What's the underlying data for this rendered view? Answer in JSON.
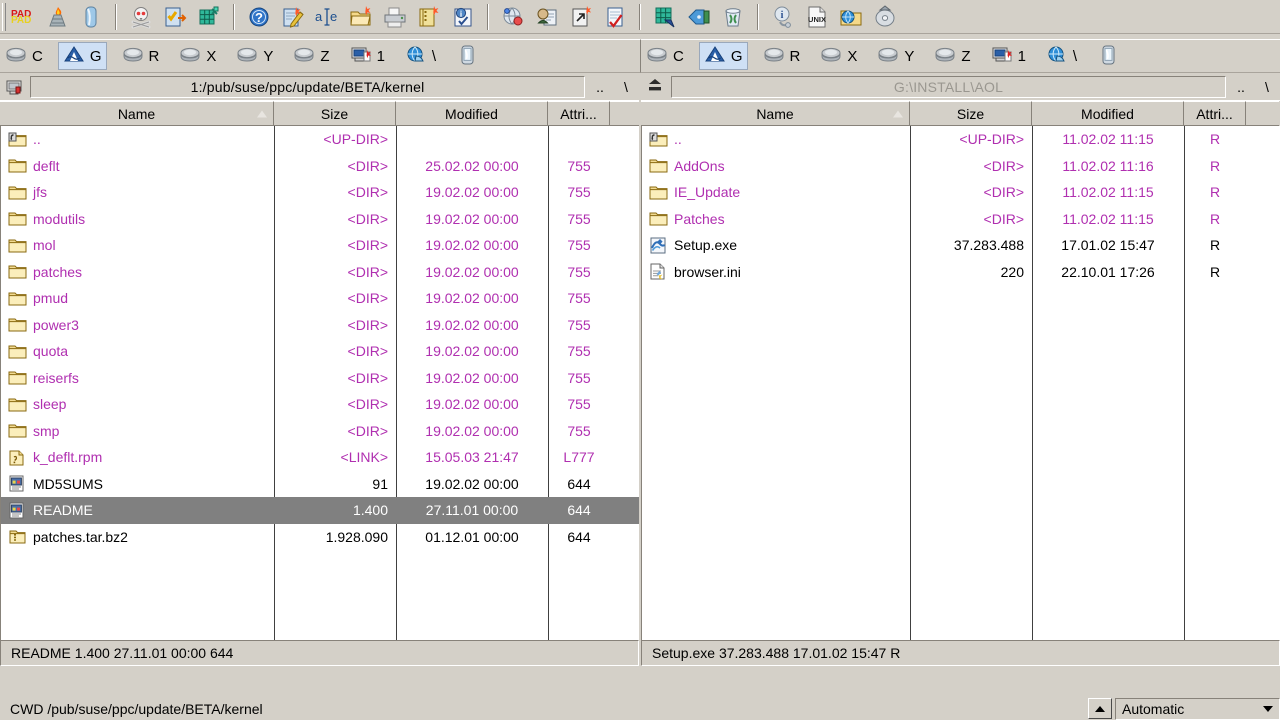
{
  "toolbar": {
    "groups": [
      {
        "buttons": [
          {
            "name": "pad-logo-icon",
            "label": "PAD"
          },
          {
            "name": "torch-icon",
            "label": "Torch"
          },
          {
            "name": "blue-column-icon",
            "label": "Column"
          }
        ]
      },
      {
        "buttons": [
          {
            "name": "skull-icon",
            "label": "Kill Process"
          },
          {
            "name": "checklist-page-icon",
            "label": "Select"
          },
          {
            "name": "green-grid-icon",
            "label": "Network Grid"
          }
        ]
      },
      {
        "buttons": [
          {
            "name": "help-icon",
            "label": "Help"
          },
          {
            "name": "edit-note-icon",
            "label": "Edit"
          },
          {
            "name": "rename-ae-icon",
            "label": "Rename"
          },
          {
            "name": "new-folder-icon",
            "label": "New Folder"
          },
          {
            "name": "print-icon",
            "label": "Print"
          },
          {
            "name": "new-archive-icon",
            "label": "Pack"
          },
          {
            "name": "properties-info-icon",
            "label": "Properties"
          }
        ]
      },
      {
        "buttons": [
          {
            "name": "ftp-connect-icon",
            "label": "FTP Connect"
          },
          {
            "name": "ftp-new-connection-icon",
            "label": "New Connection"
          },
          {
            "name": "shortcut-new-icon",
            "label": "Create Shortcut"
          },
          {
            "name": "verify-page-icon",
            "label": "Verify"
          }
        ]
      },
      {
        "buttons": [
          {
            "name": "hex-compare-icon",
            "label": "Compare"
          },
          {
            "name": "tag-sync-icon",
            "label": "Synchronize"
          },
          {
            "name": "recycle-bin-icon",
            "label": "Recycle Bin"
          }
        ]
      },
      {
        "buttons": [
          {
            "name": "system-info-icon",
            "label": "System Info"
          },
          {
            "name": "unix-file-icon",
            "label": "UNIX"
          },
          {
            "name": "globe-folder-icon",
            "label": "Network"
          },
          {
            "name": "disc-eject-icon",
            "label": "Eject"
          }
        ]
      }
    ]
  },
  "drivebar": {
    "items": [
      {
        "name": "drive-c",
        "label": "C",
        "icon": "drive-icon",
        "active": false
      },
      {
        "name": "drive-g",
        "label": "G",
        "icon": "cdrom-icon",
        "active": true
      },
      {
        "name": "drive-r",
        "label": "R",
        "icon": "drive-icon",
        "active": false
      },
      {
        "name": "drive-x",
        "label": "X",
        "icon": "drive-icon",
        "active": false
      },
      {
        "name": "drive-y",
        "label": "Y",
        "icon": "drive-icon",
        "active": false
      },
      {
        "name": "drive-z",
        "label": "Z",
        "icon": "drive-icon",
        "active": false
      },
      {
        "name": "drive-1",
        "label": "1",
        "icon": "ftp-server-icon",
        "active": false
      },
      {
        "name": "drive-backslash",
        "label": "\\",
        "icon": "network-globe-icon",
        "active": false
      },
      {
        "name": "drive-device",
        "label": "",
        "icon": "handheld-device-icon",
        "active": false
      }
    ]
  },
  "columns": {
    "name": "Name",
    "size": "Size",
    "modified": "Modified",
    "attributes": "Attri..."
  },
  "left_panel": {
    "path": "1:/pub/suse/ppc/update/BETA/kernel",
    "path_icon": "ftp-server-icon",
    "path_up_label": "..",
    "path_root_label": "\\",
    "status": "README   1.400 27.11.01  00:00  644",
    "rows": [
      {
        "icon": "up-dir-icon",
        "name": "..",
        "size": "<UP-DIR>",
        "modified": "",
        "attr": "",
        "kind": "dir",
        "selected": false
      },
      {
        "icon": "folder-icon",
        "name": "deflt",
        "size": "<DIR>",
        "modified": "25.02.02  00:00",
        "attr": "755",
        "kind": "dir",
        "selected": false
      },
      {
        "icon": "folder-icon",
        "name": "jfs",
        "size": "<DIR>",
        "modified": "19.02.02  00:00",
        "attr": "755",
        "kind": "dir",
        "selected": false
      },
      {
        "icon": "folder-icon",
        "name": "modutils",
        "size": "<DIR>",
        "modified": "19.02.02  00:00",
        "attr": "755",
        "kind": "dir",
        "selected": false
      },
      {
        "icon": "folder-icon",
        "name": "mol",
        "size": "<DIR>",
        "modified": "19.02.02  00:00",
        "attr": "755",
        "kind": "dir",
        "selected": false
      },
      {
        "icon": "folder-icon",
        "name": "patches",
        "size": "<DIR>",
        "modified": "19.02.02  00:00",
        "attr": "755",
        "kind": "dir",
        "selected": false
      },
      {
        "icon": "folder-icon",
        "name": "pmud",
        "size": "<DIR>",
        "modified": "19.02.02  00:00",
        "attr": "755",
        "kind": "dir",
        "selected": false
      },
      {
        "icon": "folder-icon",
        "name": "power3",
        "size": "<DIR>",
        "modified": "19.02.02  00:00",
        "attr": "755",
        "kind": "dir",
        "selected": false
      },
      {
        "icon": "folder-icon",
        "name": "quota",
        "size": "<DIR>",
        "modified": "19.02.02  00:00",
        "attr": "755",
        "kind": "dir",
        "selected": false
      },
      {
        "icon": "folder-icon",
        "name": "reiserfs",
        "size": "<DIR>",
        "modified": "19.02.02  00:00",
        "attr": "755",
        "kind": "dir",
        "selected": false
      },
      {
        "icon": "folder-icon",
        "name": "sleep",
        "size": "<DIR>",
        "modified": "19.02.02  00:00",
        "attr": "755",
        "kind": "dir",
        "selected": false
      },
      {
        "icon": "folder-icon",
        "name": "smp",
        "size": "<DIR>",
        "modified": "19.02.02  00:00",
        "attr": "755",
        "kind": "dir",
        "selected": false
      },
      {
        "icon": "rpm-link-icon",
        "name": "k_deflt.rpm",
        "size": "<LINK>",
        "modified": "15.05.03  21:47",
        "attr": "L777",
        "kind": "dir",
        "selected": false
      },
      {
        "icon": "text-doc-icon",
        "name": "MD5SUMS",
        "size": "91",
        "modified": "19.02.02  00:00",
        "attr": "644",
        "kind": "file",
        "selected": false
      },
      {
        "icon": "text-doc-icon",
        "name": "README",
        "size": "1.400",
        "modified": "27.11.01  00:00",
        "attr": "644",
        "kind": "file",
        "selected": true
      },
      {
        "icon": "archive-icon",
        "name": "patches.tar.bz2",
        "size": "1.928.090",
        "modified": "01.12.01  00:00",
        "attr": "644",
        "kind": "file",
        "selected": false
      }
    ]
  },
  "right_panel": {
    "path": "G:\\INSTALL\\AOL",
    "path_icon": "disc-eject-icon",
    "path_up_label": "..",
    "path_root_label": "\\",
    "status": "Setup.exe   37.283.488 17.01.02  15:47  R",
    "rows": [
      {
        "icon": "up-dir-icon",
        "name": "..",
        "size": "<UP-DIR>",
        "modified": "11.02.02  11:15",
        "attr": "R",
        "kind": "dir",
        "selected": false
      },
      {
        "icon": "folder-icon",
        "name": "AddOns",
        "size": "<DIR>",
        "modified": "11.02.02  11:16",
        "attr": "R",
        "kind": "dir",
        "selected": false
      },
      {
        "icon": "folder-icon",
        "name": "IE_Update",
        "size": "<DIR>",
        "modified": "11.02.02  11:15",
        "attr": "R",
        "kind": "dir",
        "selected": false
      },
      {
        "icon": "folder-icon",
        "name": "Patches",
        "size": "<DIR>",
        "modified": "11.02.02  11:15",
        "attr": "R",
        "kind": "dir",
        "selected": false
      },
      {
        "icon": "exe-icon",
        "name": "Setup.exe",
        "size": "37.283.488",
        "modified": "17.01.02  15:47",
        "attr": "R",
        "kind": "file",
        "selected": false
      },
      {
        "icon": "ini-file-icon",
        "name": "browser.ini",
        "size": "220",
        "modified": "22.10.01  17:26",
        "attr": "R",
        "kind": "file",
        "selected": false
      }
    ]
  },
  "bottom": {
    "command_line": "CWD /pub/suse/ppc/update/BETA/kernel",
    "transfer_mode": "Automatic",
    "scroll_up_name": "scroll-up-button"
  },
  "colors": {
    "directory_text": "#b02fb0",
    "file_text": "#000000",
    "selection_bg": "#808080",
    "selection_text": "#ffffff",
    "panel_bg": "#ffffff",
    "chrome_bg": "#d4d0c8",
    "active_drive_bg": "#cfe0f5"
  }
}
